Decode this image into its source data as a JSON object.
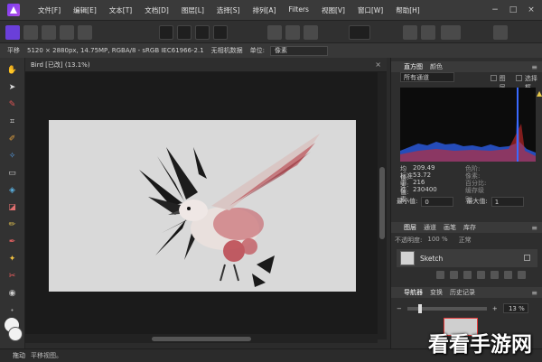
{
  "menubar": {
    "items": [
      "文件[F]",
      "编辑[E]",
      "文本[T]",
      "文档[D]",
      "图层[L]",
      "选择[S]",
      "排列[A]",
      "Filters",
      "视图[V]",
      "窗口[W]",
      "帮助[H]"
    ],
    "window_buttons": [
      "−",
      "□",
      "×"
    ]
  },
  "context": {
    "tool": "平移",
    "info": "5120 × 2880px, 14.75MP, RGBA/8 - sRGB IEC61966-2.1",
    "camera": "无相机数据",
    "units_label": "单位:",
    "units_value": "像素"
  },
  "document": {
    "tab_title": "Bird [已改] (13.1%)",
    "close": "×"
  },
  "panels": {
    "histogram_tabs": [
      "直方图",
      "颜色"
    ],
    "channel": "所有通道",
    "check_layer": "图层",
    "check_selection": "选择框",
    "warning": "▲",
    "stats": [
      {
        "k": "均值:",
        "v": "209.49",
        "k2": "色阶:",
        "v2": ""
      },
      {
        "k": "标准差:",
        "v": "53.72",
        "k2": "像素:",
        "v2": ""
      },
      {
        "k": "中值:",
        "v": "216",
        "k2": "百分比:",
        "v2": ""
      },
      {
        "k": "像素:",
        "v": "230400",
        "k2": "缓存级别:",
        "v2": ""
      }
    ],
    "min_label": "最小值:",
    "min_value": "0",
    "max_label": "最大值:",
    "max_value": "1",
    "layer_tabs": [
      "图层",
      "通道",
      "画笔",
      "库存"
    ],
    "opacity_label": "不透明度:",
    "opacity_value": "100 %",
    "blend_value": "正常",
    "layer_name": "Sketch",
    "nav_tabs": [
      "导航器",
      "变换",
      "历史记录"
    ],
    "zoom_minus": "−",
    "zoom_plus": "+",
    "zoom_value": "13 %",
    "menu_glyph": "≡"
  },
  "status": {
    "tool": "拖动",
    "hint": "平移视图。"
  },
  "watermark": "看看手游网",
  "colors": {
    "accent": "#6a3fd9",
    "histogram_blue": "#2a58d8",
    "histogram_red": "#d02a2a",
    "artboard": "#d9d9d9"
  }
}
